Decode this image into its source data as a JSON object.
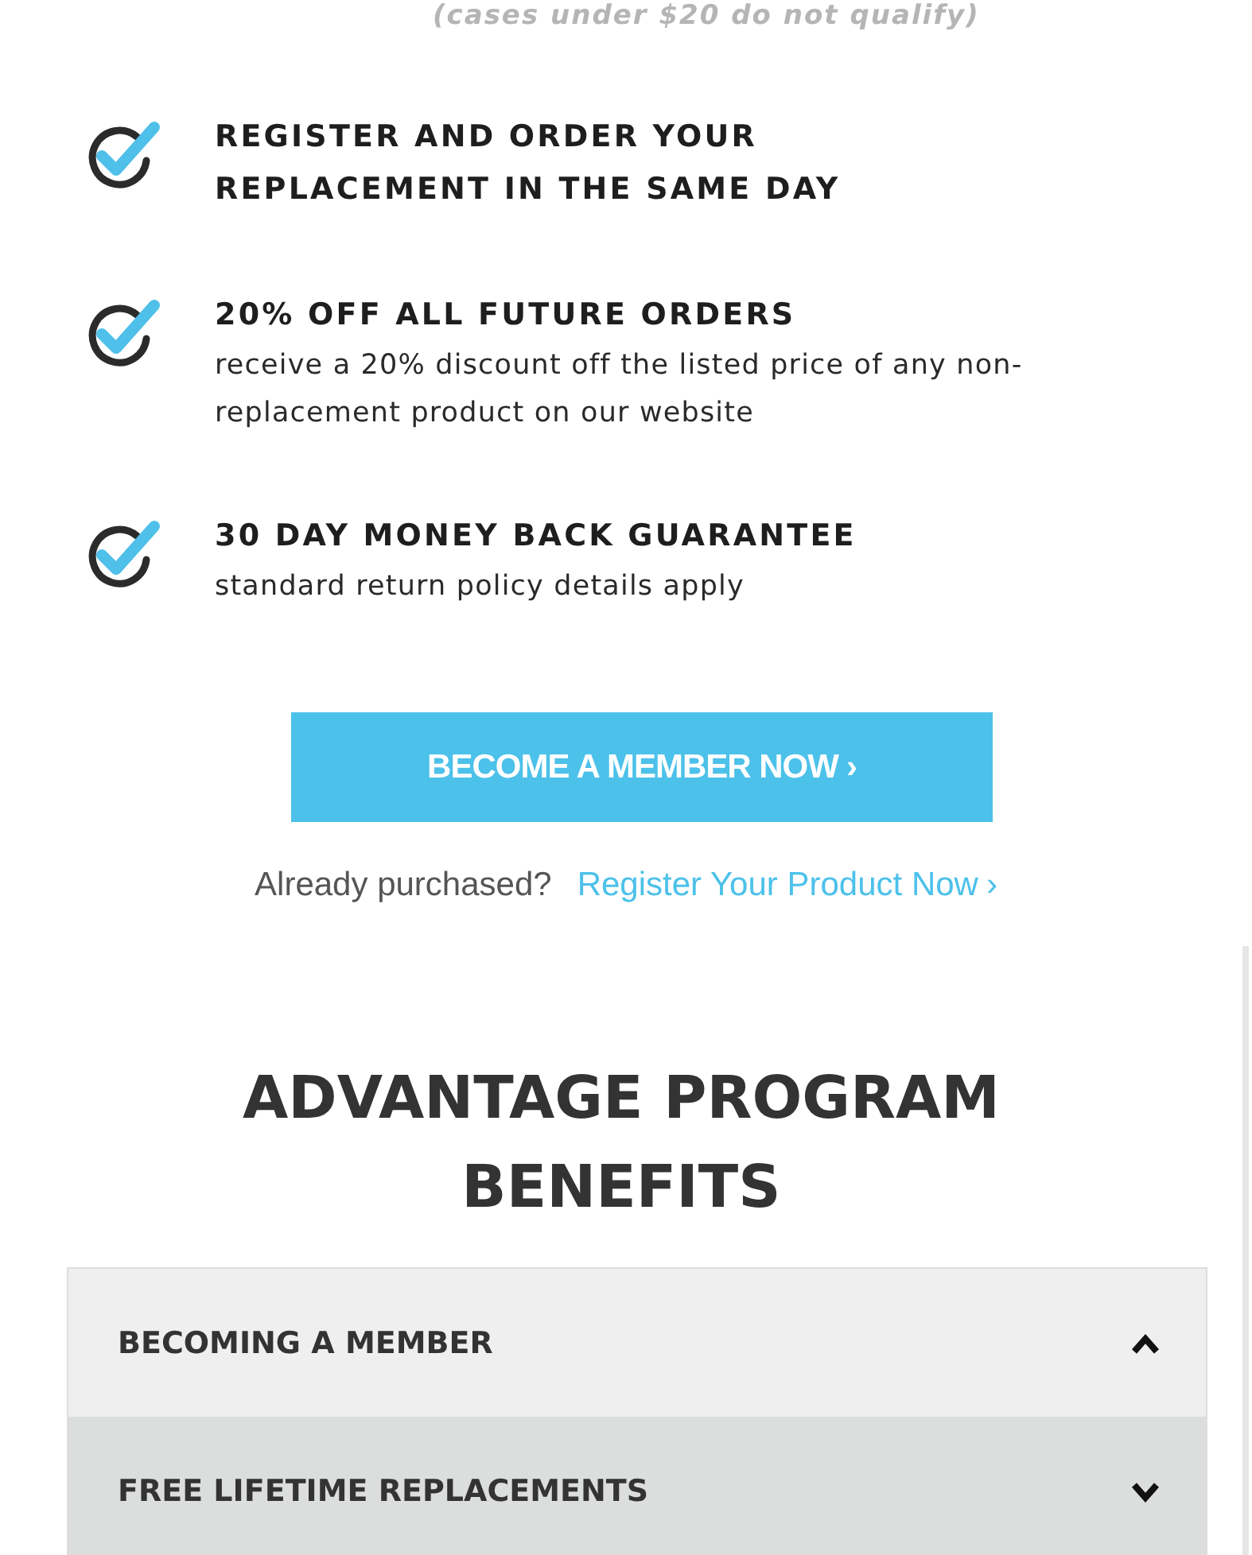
{
  "note": "(cases under $20 do not qualify)",
  "benefits": [
    {
      "title": "REGISTER AND ORDER YOUR REPLACEMENT IN THE SAME DAY"
    },
    {
      "title": "20% OFF ALL FUTURE ORDERS",
      "description": "receive a 20% discount off the listed price of any non-replacement product on our website"
    },
    {
      "title": "30 DAY MONEY BACK GUARANTEE",
      "description": "standard return policy details apply"
    }
  ],
  "cta_button": "BECOME A MEMBER NOW",
  "cta_chevron": "›",
  "register_prompt": "Already purchased?",
  "register_link": "Register Your Product Now",
  "register_chevron": "›",
  "section_title": "ADVANTAGE PROGRAM BENEFITS",
  "accordion": [
    {
      "title": "BECOMING A MEMBER",
      "expanded": true
    },
    {
      "title": "FREE LIFETIME REPLACEMENTS",
      "expanded": false
    }
  ]
}
